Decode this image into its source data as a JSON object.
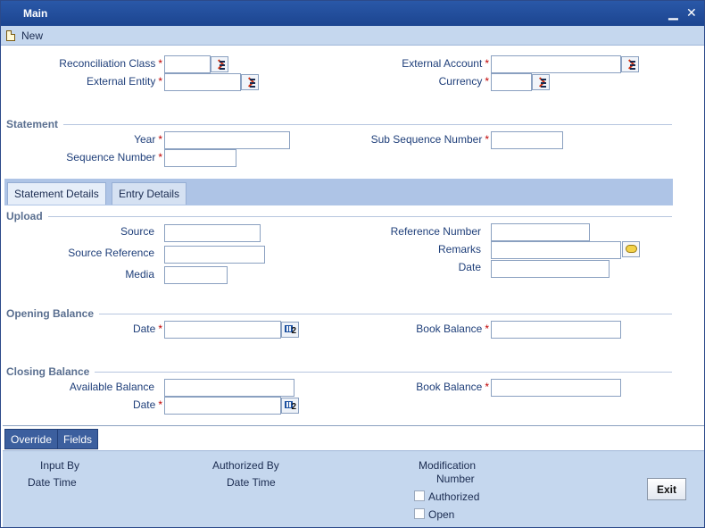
{
  "window": {
    "title": "Main",
    "minimize_glyph": "▁",
    "close_glyph": "✕"
  },
  "toolbar": {
    "new_label": "New"
  },
  "header": {
    "reconciliation_class": {
      "label": "Reconciliation Class",
      "value": ""
    },
    "external_entity": {
      "label": "External Entity",
      "value": ""
    },
    "external_account": {
      "label": "External Account",
      "value": ""
    },
    "currency": {
      "label": "Currency",
      "value": ""
    }
  },
  "statement": {
    "section_title": "Statement",
    "year": {
      "label": "Year",
      "value": ""
    },
    "sequence_number": {
      "label": "Sequence Number",
      "value": ""
    },
    "sub_sequence_number": {
      "label": "Sub Sequence Number",
      "value": ""
    }
  },
  "tabs": [
    {
      "label": "Statement Details",
      "active": true
    },
    {
      "label": "Entry Details",
      "active": false
    }
  ],
  "upload": {
    "section_title": "Upload",
    "source": {
      "label": "Source",
      "value": ""
    },
    "source_reference": {
      "label": "Source Reference",
      "value": ""
    },
    "media": {
      "label": "Media",
      "value": ""
    },
    "reference_number": {
      "label": "Reference Number",
      "value": ""
    },
    "remarks": {
      "label": "Remarks",
      "value": ""
    },
    "date": {
      "label": "Date",
      "value": ""
    }
  },
  "opening_balance": {
    "section_title": "Opening Balance",
    "date": {
      "label": "Date",
      "value": ""
    },
    "book_balance": {
      "label": "Book Balance",
      "value": ""
    }
  },
  "closing_balance": {
    "section_title": "Closing Balance",
    "available_balance": {
      "label": "Available Balance",
      "value": ""
    },
    "date": {
      "label": "Date",
      "value": ""
    },
    "book_balance": {
      "label": "Book Balance",
      "value": ""
    }
  },
  "calendar_glyph": "2",
  "required_marker": "*",
  "subscreen_buttons": {
    "override": "Override",
    "fields": "Fields"
  },
  "footer": {
    "input_by": "Input By",
    "date_time_1": "Date Time",
    "authorized_by": "Authorized By",
    "date_time_2": "Date Time",
    "modification": "Modification",
    "number": "Number",
    "authorized": "Authorized",
    "open": "Open",
    "exit": "Exit"
  }
}
